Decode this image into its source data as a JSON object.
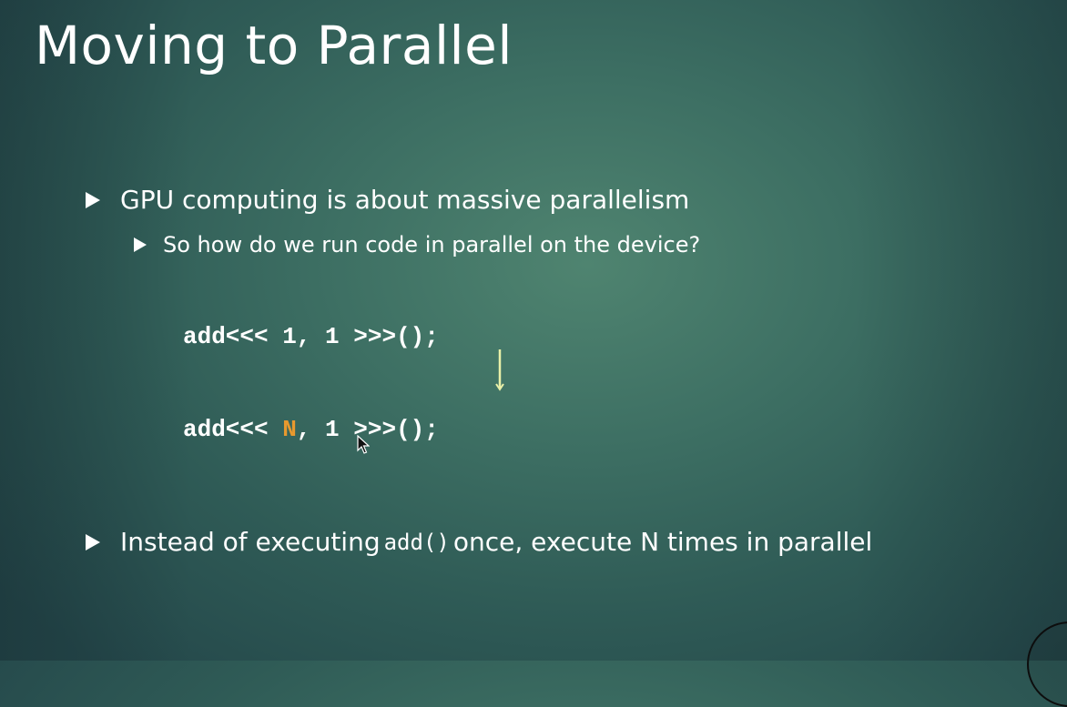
{
  "slide": {
    "title": "Moving to Parallel",
    "bullets": [
      {
        "text": "GPU computing is about massive parallelism"
      },
      {
        "text": "So how do we run code in parallel on the device?"
      }
    ],
    "code": {
      "line1": {
        "prefix": "add<<< ",
        "arg1": "1",
        "middle": ", ",
        "arg2": "1",
        "suffix": " >>>();"
      },
      "line2": {
        "prefix": "add<<< ",
        "arg1": "N",
        "middle": ", ",
        "arg2": "1",
        "suffix": " >>>();"
      }
    },
    "last_bullet": {
      "before": "Instead of executing",
      "code": "add()",
      "after": "once, execute N times in parallel"
    }
  },
  "colors": {
    "background": "#3d6f63",
    "text": "#ffffff",
    "accent": "#e8992e",
    "arrow": "#e9f0a8"
  },
  "icons": [
    "bullet-triangle-icon",
    "down-arrow-icon",
    "mouse-cursor-icon"
  ]
}
